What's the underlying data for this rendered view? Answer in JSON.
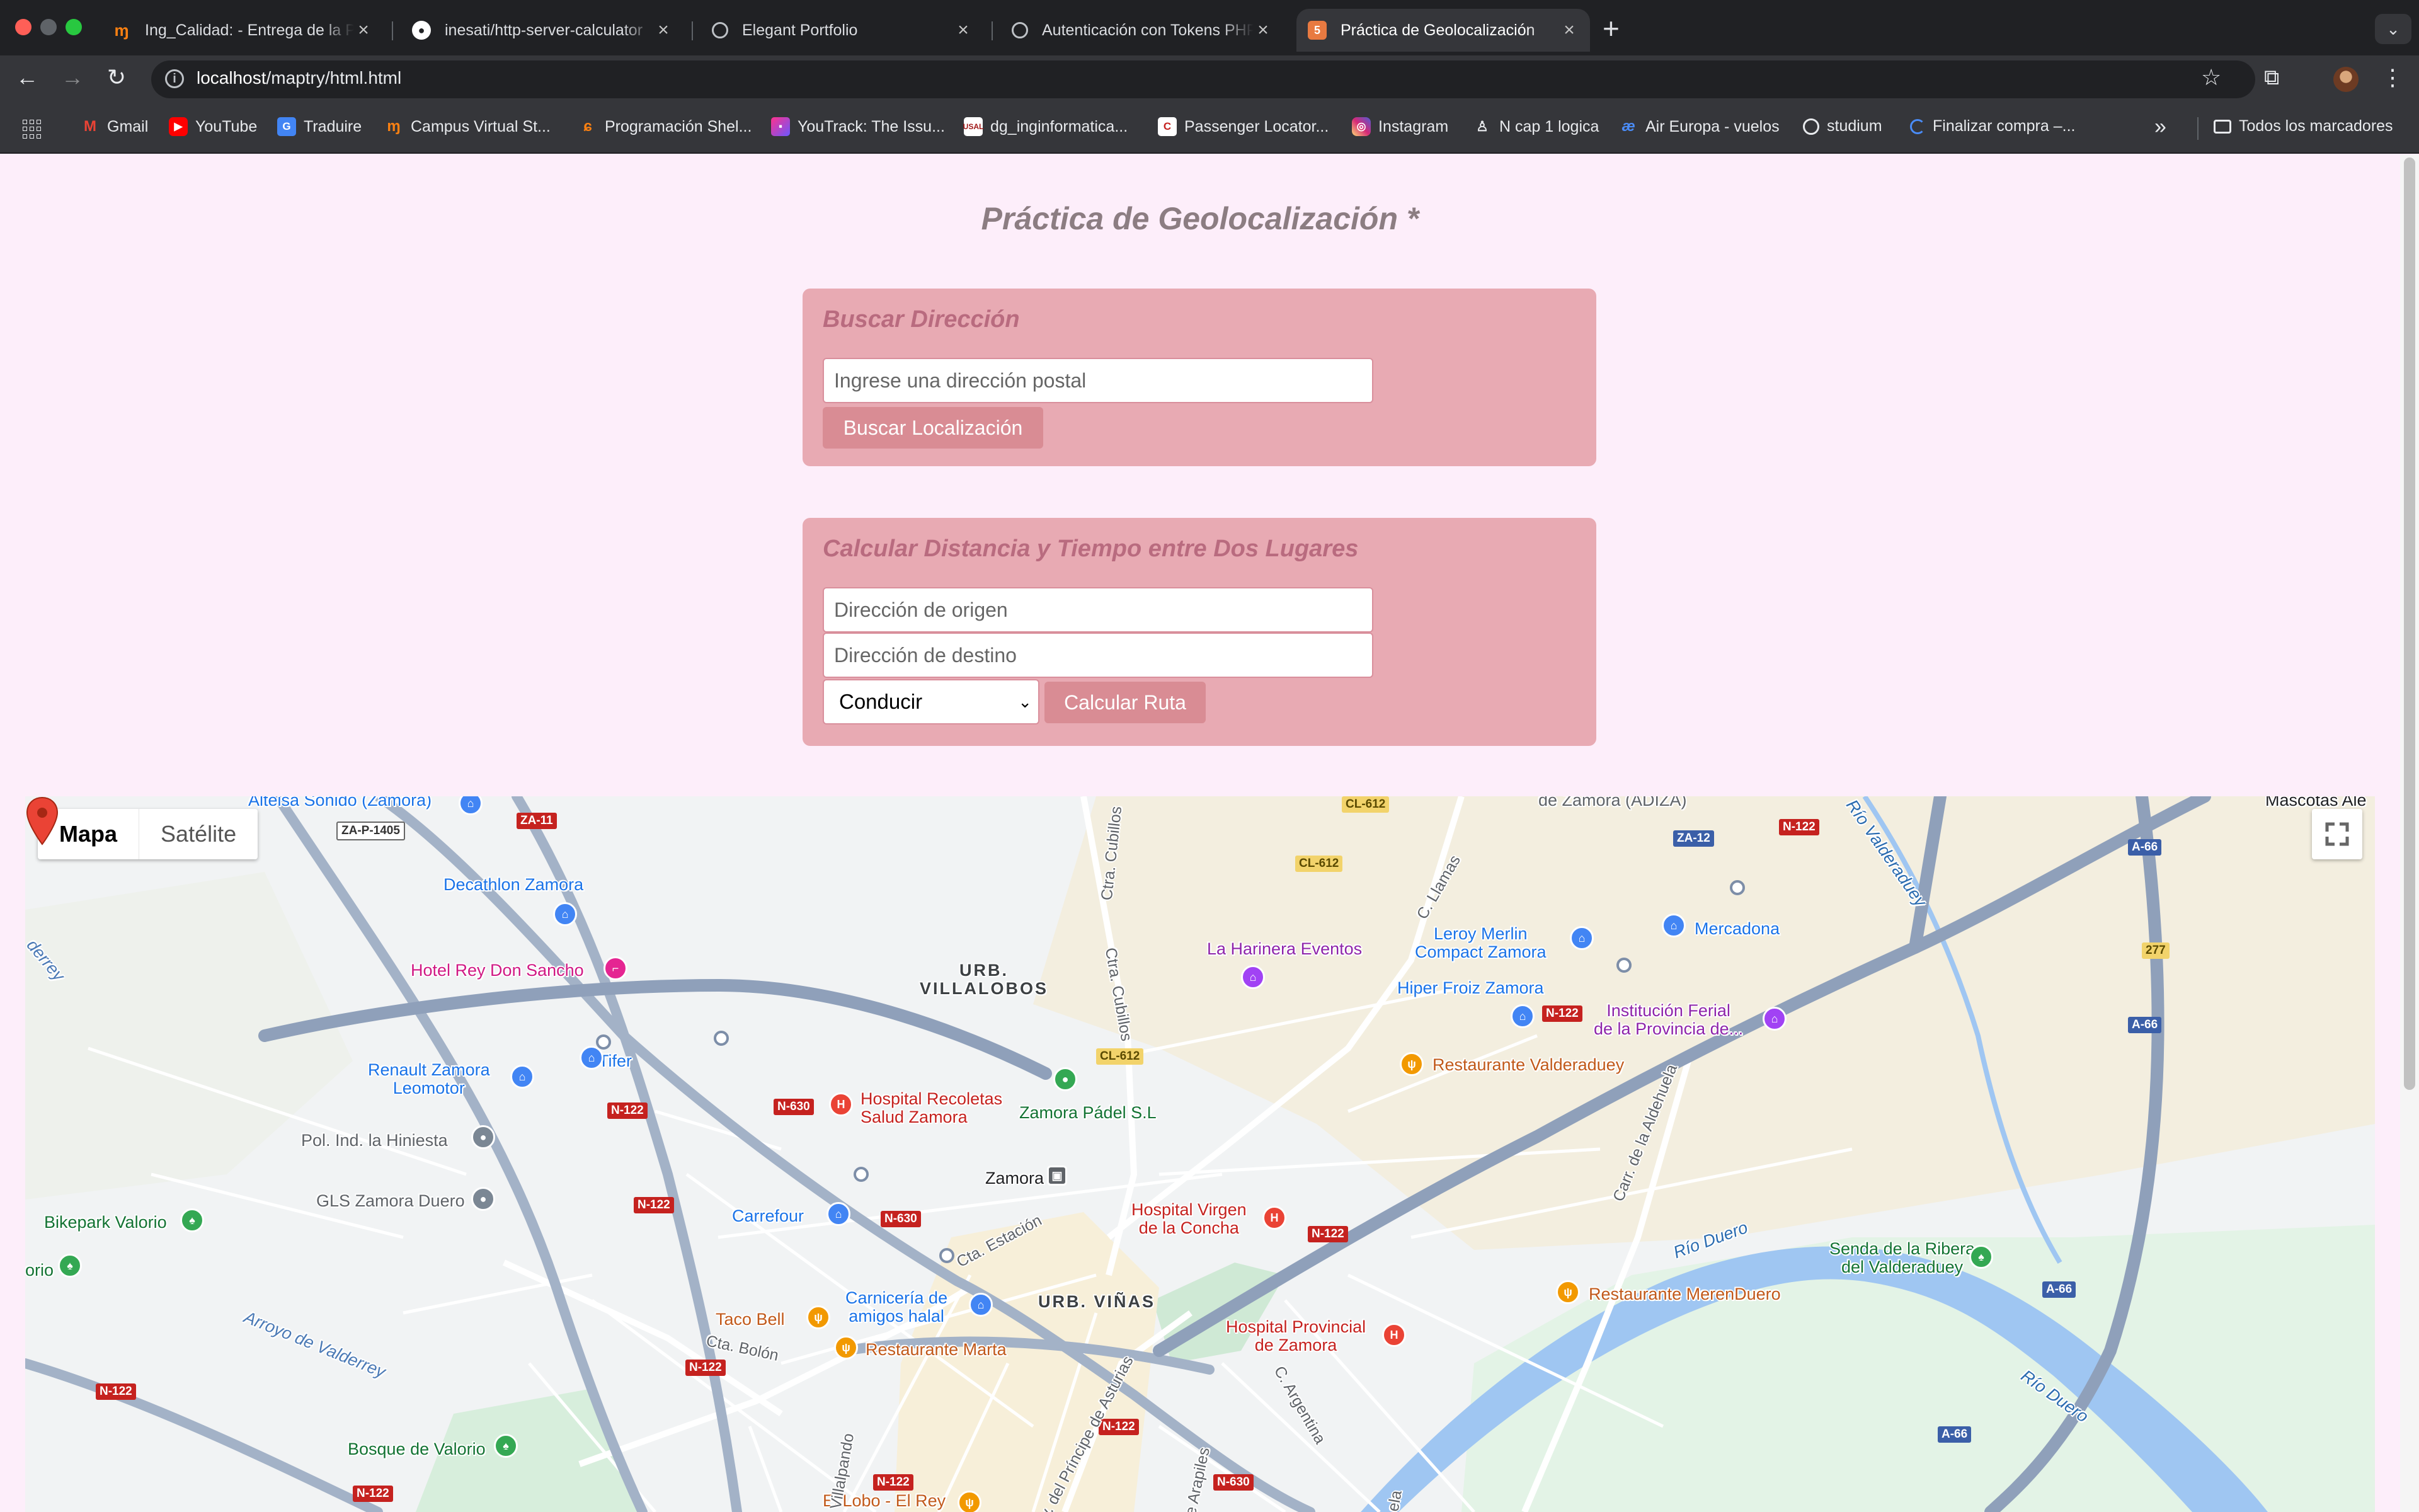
{
  "browser": {
    "tabs": [
      {
        "title": "Ing_Calidad: - Entrega de la P",
        "icon": "moodle-icon",
        "active": false
      },
      {
        "title": "inesati/http-server-calculator",
        "icon": "github-icon",
        "active": false
      },
      {
        "title": "Elegant Portfolio",
        "icon": "globe-icon",
        "active": false
      },
      {
        "title": "Autenticación con Tokens PHP",
        "icon": "globe-icon",
        "active": false
      },
      {
        "title": "Práctica de Geolocalización",
        "icon": "html-icon",
        "active": true
      }
    ],
    "url_host": "localhost",
    "url_path": "/maptry/html.html",
    "bookmarks": [
      "Gmail",
      "YouTube",
      "Traduire",
      "Campus Virtual St...",
      "Programación Shel...",
      "YouTrack: The Issu...",
      "dg_inginformatica...",
      "Passenger Locator...",
      "Instagram",
      "N cap 1 logica",
      "Air Europa - vuelos",
      "studium",
      "Finalizar compra –..."
    ],
    "all_bookmarks": "Todos los marcadores"
  },
  "page": {
    "title": "Práctica de Geolocalización *",
    "search": {
      "heading": "Buscar Dirección",
      "placeholder": "Ingrese una dirección postal",
      "button": "Buscar Localización"
    },
    "route": {
      "heading": "Calcular Distancia y Tiempo entre Dos Lugares",
      "origin_placeholder": "Dirección de origen",
      "destination_placeholder": "Dirección de destino",
      "mode": "Conducir",
      "button": "Calcular Ruta"
    }
  },
  "map": {
    "type_map": "Mapa",
    "type_satellite": "Satélite",
    "labels": {
      "alteisa": "Alteisa Sonido (Zamora)",
      "adiza": "de Zamora (ADIZA)",
      "mascotas": "Mascotas Ale",
      "decathlon": "Decathlon Zamora",
      "hotel": "Hotel Rey Don Sancho",
      "renault": "Renault Zamora\nLeomotor",
      "tifer": "Tifer",
      "hiniesta": "Pol. Ind. la Hiniesta",
      "gls": "GLS Zamora Duero",
      "bikepark": "Bikepark Valorio",
      "orio": "orio",
      "villalobos": "URB.\nVILLALOBOS",
      "harinera": "La Harinera Eventos",
      "leroy": "Leroy Merlin\nCompact Zamora",
      "mercadona": "Mercadona",
      "hiper": "Hiper Froiz Zamora",
      "ferial": "Institución Ferial\nde la Provincia de...",
      "valderaduey_rest": "Restaurante Valderaduey",
      "recoletas": "Hospital Recoletas\nSalud Zamora",
      "padel": "Zamora Pádel S.L",
      "zamora": "Zamora",
      "carrefour": "Carrefour",
      "virgen": "Hospital Virgen\nde la Concha",
      "vinas": "URB. VIÑAS",
      "carniceria": "Carnicería de\namigos halal",
      "tacobell": "Taco Bell",
      "marta": "Restaurante Marta",
      "provincial": "Hospital Provincial\nde Zamora",
      "merenduero": "Restaurante MerenDuero",
      "senda": "Senda de la Ribera\ndel Valderaduey",
      "rio_duero_1": "Río Duero",
      "rio_duero_2": "Río Duero",
      "rio_valderaduey": "Río Valderaduey",
      "arroyo": "Arroyo de Valderrey",
      "bosque": "Bosque de Valorio",
      "lobo": "El Lobo - El Rey",
      "ctra_cubillos_1": "Ctra. Cubillos",
      "ctra_cubillos_2": "Ctra. Cubillos",
      "c_llamas": "C. Llamas",
      "aldehuela": "Carr. de la Aldehuela",
      "cta_estacion": "Cta. Estación",
      "cta_bolon": "Cta. Bolón",
      "principe": "Av. del Príncipe de Asturias",
      "argentina": "C. Argentina",
      "arapiles": "de Arapiles",
      "villalpando": "de Villalpando",
      "derrey": "derrey",
      "ela": "ela"
    },
    "shields": {
      "za11": "ZA-11",
      "zap1405": "ZA-P-1405",
      "cl612a": "CL-612",
      "cl612b": "CL-612",
      "cl612c": "CL-612",
      "za12": "ZA-12",
      "n122a": "N-122",
      "a66a": "A-66",
      "s277": "277",
      "a66b": "A-66",
      "n122b": "N-122",
      "n122c": "N-122",
      "n630a": "N-630",
      "n630b": "N-630",
      "n122d": "N-122",
      "n122e": "N-122",
      "n122f": "N-122",
      "n122g": "N-122",
      "n122h": "N-122",
      "a66c": "A-66",
      "a66d": "A-66",
      "n122i": "N-122",
      "n122j": "N-122",
      "n630c": "N-630"
    }
  }
}
